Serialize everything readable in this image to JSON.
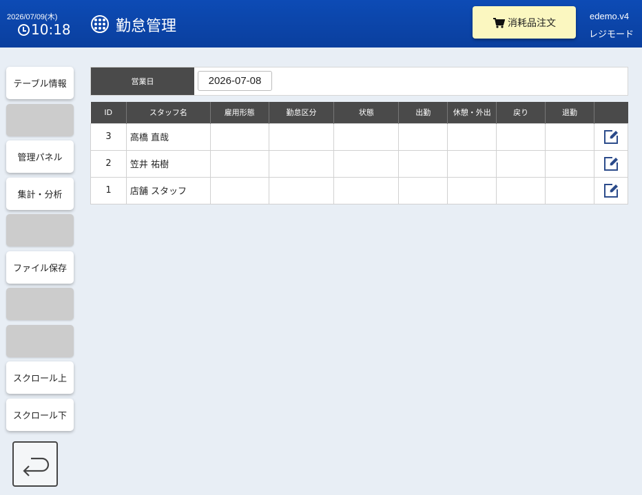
{
  "header": {
    "date": "2026/07/09(木)",
    "time": "10:18",
    "title": "勤怠管理",
    "order_button": "消耗品注文",
    "version": "edemo.v4",
    "mode": "レジモード"
  },
  "sidebar": {
    "items": [
      {
        "label": "テーブル情報"
      },
      {
        "label": ""
      },
      {
        "label": "管理パネル"
      },
      {
        "label": "集計・分析"
      },
      {
        "label": ""
      },
      {
        "label": "ファイル保存"
      },
      {
        "label": ""
      },
      {
        "label": ""
      },
      {
        "label": "スクロール上"
      },
      {
        "label": "スクロール下"
      }
    ]
  },
  "business_day": {
    "label": "営業日",
    "value": "2026-07-08"
  },
  "table": {
    "headers": [
      "ID",
      "スタッフ名",
      "雇用形態",
      "勤怠区分",
      "状態",
      "出勤",
      "休憩・外出",
      "戻り",
      "退勤",
      ""
    ],
    "rows": [
      {
        "id": "3",
        "name": "高橋 直哉",
        "employment": "",
        "category": "",
        "status": "",
        "clock_in": "",
        "break": "",
        "return": "",
        "clock_out": ""
      },
      {
        "id": "2",
        "name": "笠井 祐樹",
        "employment": "",
        "category": "",
        "status": "",
        "clock_in": "",
        "break": "",
        "return": "",
        "clock_out": ""
      },
      {
        "id": "1",
        "name": "店舗 スタッフ",
        "employment": "",
        "category": "",
        "status": "",
        "clock_in": "",
        "break": "",
        "return": "",
        "clock_out": ""
      }
    ]
  },
  "colors": {
    "header_bg": "#0a3f9e",
    "order_button_bg": "#fbf7c0",
    "table_header_bg": "#4a4a4a",
    "edit_icon": "#2a4a8a"
  }
}
